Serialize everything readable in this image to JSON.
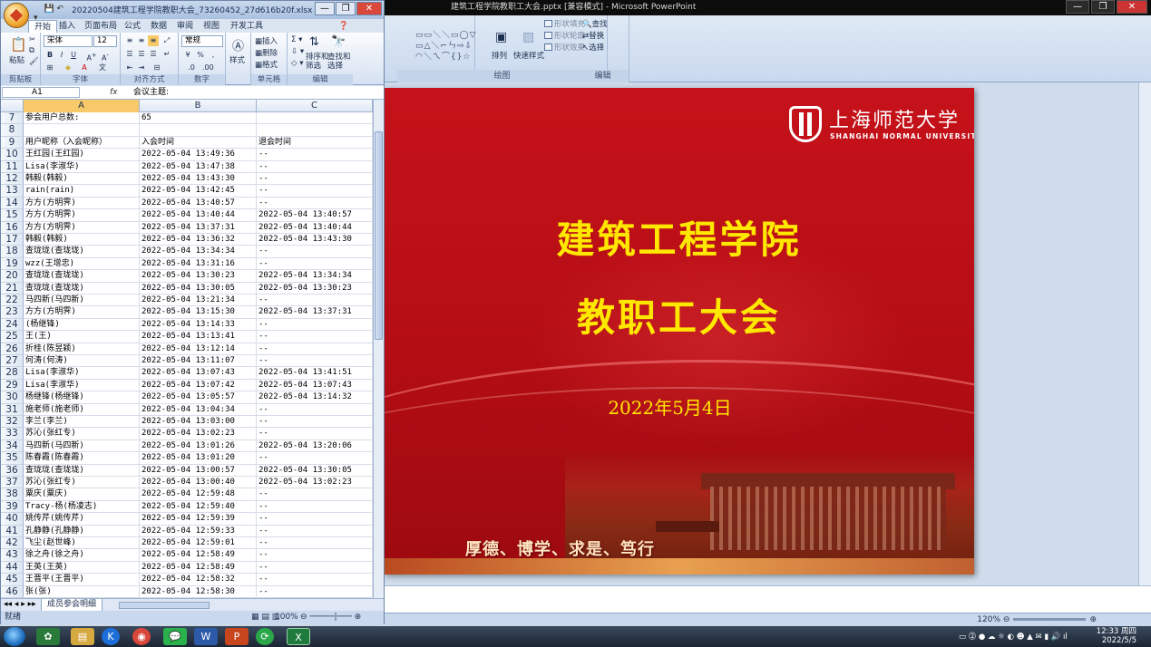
{
  "ppt": {
    "title": "建筑工程学院教职工大会.pptx [兼容模式] - Microsoft PowerPoint",
    "ribbon": {
      "drawing_label": "绘图",
      "editing_label": "编辑",
      "arrange": "排列",
      "quick_styles": "快速样式",
      "shape_fill": "形状填充",
      "shape_outline": "形状轮廓",
      "shape_effects": "形状效果",
      "find": "查找",
      "replace": "替换",
      "select": "选择"
    },
    "status": {
      "zoom": "120%"
    }
  },
  "slide": {
    "logo_cn": "上海师范大学",
    "logo_en": "SHANGHAI NORMAL UNIVERSITY",
    "title1": "建筑工程学院",
    "title2": "教职工大会",
    "date": "2022年5月4日",
    "motto": "厚德、博学、求是、笃行"
  },
  "excel": {
    "title": "20220504建筑工程学院教职大会_73260452_27d616b20f.xlsx - Microsoft Excel",
    "tabs": [
      "开始",
      "插入",
      "页面布局",
      "公式",
      "数据",
      "审阅",
      "视图",
      "开发工具"
    ],
    "ribbon": {
      "paste": "粘贴",
      "clipboard": "剪贴板",
      "font_name": "宋体",
      "font_size": "12",
      "font_group": "字体",
      "align_group": "对齐方式",
      "number_format": "常规",
      "number_group": "数字",
      "styles": "样式",
      "insert": "插入",
      "delete": "删除",
      "format": "格式",
      "cells_group": "单元格",
      "sort_filter": "排序和\n筛选",
      "find_select": "查找和\n选择",
      "edit_group": "编辑"
    },
    "name_box": "A1",
    "formula": "会议主题:",
    "columns": [
      "A",
      "B",
      "C"
    ],
    "rows": [
      {
        "n": "7",
        "a": "参会用户总数:",
        "b": "65",
        "c": ""
      },
      {
        "n": "8",
        "a": "",
        "b": "",
        "c": ""
      },
      {
        "n": "9",
        "a": "用户昵称（入会昵称）",
        "b": "入会时间",
        "c": "退会时间"
      },
      {
        "n": "10",
        "a": "王红园(王红园)",
        "b": "2022-05-04 13:49:36",
        "c": "--"
      },
      {
        "n": "11",
        "a": "Lisa(李淑华)",
        "b": "2022-05-04 13:47:38",
        "c": "--"
      },
      {
        "n": "12",
        "a": "韩毅(韩毅)",
        "b": "2022-05-04 13:43:30",
        "c": "--"
      },
      {
        "n": "13",
        "a": "rain(rain)",
        "b": "2022-05-04 13:42:45",
        "c": "--"
      },
      {
        "n": "14",
        "a": "方方(方明霁)",
        "b": "2022-05-04 13:40:57",
        "c": "--"
      },
      {
        "n": "15",
        "a": "方方(方明霁)",
        "b": "2022-05-04 13:40:44",
        "c": "2022-05-04 13:40:57"
      },
      {
        "n": "16",
        "a": "方方(方明霁)",
        "b": "2022-05-04 13:37:31",
        "c": "2022-05-04 13:40:44"
      },
      {
        "n": "17",
        "a": "韩毅(韩毅)",
        "b": "2022-05-04 13:36:32",
        "c": "2022-05-04 13:43:30"
      },
      {
        "n": "18",
        "a": "查珑珑(查珑珑)",
        "b": "2022-05-04 13:34:34",
        "c": "--"
      },
      {
        "n": "19",
        "a": "wzz(王增忠)",
        "b": "2022-05-04 13:31:16",
        "c": "--"
      },
      {
        "n": "20",
        "a": "查珑珑(查珑珑)",
        "b": "2022-05-04 13:30:23",
        "c": "2022-05-04 13:34:34"
      },
      {
        "n": "21",
        "a": "查珑珑(查珑珑)",
        "b": "2022-05-04 13:30:05",
        "c": "2022-05-04 13:30:23"
      },
      {
        "n": "22",
        "a": "马四新(马四新)",
        "b": "2022-05-04 13:21:34",
        "c": "--"
      },
      {
        "n": "23",
        "a": "方方(方明霁)",
        "b": "2022-05-04 13:15:30",
        "c": "2022-05-04 13:37:31"
      },
      {
        "n": "24",
        "a": "(杨继锋)",
        "b": "2022-05-04 13:14:33",
        "c": "--"
      },
      {
        "n": "25",
        "a": "王(王)",
        "b": "2022-05-04 13:13:41",
        "c": "--"
      },
      {
        "n": "26",
        "a": "折桂(陈昱颖)",
        "b": "2022-05-04 13:12:14",
        "c": "--"
      },
      {
        "n": "27",
        "a": "何涛(何涛)",
        "b": "2022-05-04 13:11:07",
        "c": "--"
      },
      {
        "n": "28",
        "a": "Lisa(李淑华)",
        "b": "2022-05-04 13:07:43",
        "c": "2022-05-04 13:41:51"
      },
      {
        "n": "29",
        "a": "Lisa(李淑华)",
        "b": "2022-05-04 13:07:42",
        "c": "2022-05-04 13:07:43"
      },
      {
        "n": "30",
        "a": "杨继锋(杨继锋)",
        "b": "2022-05-04 13:05:57",
        "c": "2022-05-04 13:14:32"
      },
      {
        "n": "31",
        "a": "施老师(施老师)",
        "b": "2022-05-04 13:04:34",
        "c": "--"
      },
      {
        "n": "32",
        "a": "李兰(李兰)",
        "b": "2022-05-04 13:03:00",
        "c": "--"
      },
      {
        "n": "33",
        "a": "苏沁(张红专)",
        "b": "2022-05-04 13:02:23",
        "c": "--"
      },
      {
        "n": "34",
        "a": "马四新(马四新)",
        "b": "2022-05-04 13:01:26",
        "c": "2022-05-04 13:20:06"
      },
      {
        "n": "35",
        "a": "陈春霞(陈春霞)",
        "b": "2022-05-04 13:01:20",
        "c": "--"
      },
      {
        "n": "36",
        "a": "查珑珑(查珑珑)",
        "b": "2022-05-04 13:00:57",
        "c": "2022-05-04 13:30:05"
      },
      {
        "n": "37",
        "a": "苏沁(张红专)",
        "b": "2022-05-04 13:00:40",
        "c": "2022-05-04 13:02:23"
      },
      {
        "n": "38",
        "a": "粟庆(粟庆)",
        "b": "2022-05-04 12:59:48",
        "c": "--"
      },
      {
        "n": "39",
        "a": "Tracy-杨(杨凌志)",
        "b": "2022-05-04 12:59:40",
        "c": "--"
      },
      {
        "n": "40",
        "a": "姚传芹(姚传芹)",
        "b": "2022-05-04 12:59:39",
        "c": "--"
      },
      {
        "n": "41",
        "a": "孔静静(孔静静)",
        "b": "2022-05-04 12:59:33",
        "c": "--"
      },
      {
        "n": "42",
        "a": "飞尘(赵世峰)",
        "b": "2022-05-04 12:59:01",
        "c": "--"
      },
      {
        "n": "43",
        "a": "徐之舟(徐之舟)",
        "b": "2022-05-04 12:58:49",
        "c": "--"
      },
      {
        "n": "44",
        "a": "王英(王英)",
        "b": "2022-05-04 12:58:49",
        "c": "--"
      },
      {
        "n": "45",
        "a": "王晋平(王晋平)",
        "b": "2022-05-04 12:58:32",
        "c": "--"
      },
      {
        "n": "46",
        "a": "张(张)",
        "b": "2022-05-04 12:58:30",
        "c": "--"
      }
    ],
    "sheet_tab": "成员参会明细",
    "status_ready": "就绪",
    "zoom": "100%"
  },
  "taskbar": {
    "time": "12:33 周四",
    "date": "2022/5/5"
  }
}
